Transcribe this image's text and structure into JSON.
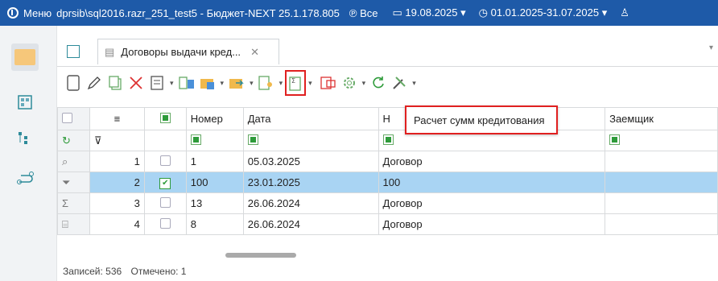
{
  "topbar": {
    "menu": "Меню",
    "title": "dprsib\\sql2016.razr_251_test5 - Бюджет-NEXT 25.1.178.805",
    "filter": "Все",
    "date": "19.08.2025",
    "period": "01.01.2025-31.07.2025"
  },
  "tab": {
    "label": "Договоры выдачи кред..."
  },
  "tooltip": {
    "text": "Расчет сумм кредитования"
  },
  "columns": {
    "number": "Номер",
    "date": "Дата",
    "name": "Н",
    "borrower": "Заемщик"
  },
  "rows": [
    {
      "idx": "1",
      "checked": false,
      "number": "1",
      "date": "05.03.2025",
      "name": "Договор"
    },
    {
      "idx": "2",
      "checked": true,
      "number": "100",
      "date": "23.01.2025",
      "name": "100"
    },
    {
      "idx": "3",
      "checked": false,
      "number": "13",
      "date": "26.06.2024",
      "name": "Договор"
    },
    {
      "idx": "4",
      "checked": false,
      "number": "8",
      "date": "26.06.2024",
      "name": "Договор"
    }
  ],
  "status": {
    "records": "Записей: 536",
    "marked": "Отмечено: 1"
  },
  "colors": {
    "topbar": "#1e5aa8",
    "selected": "#a9d4f3",
    "highlight": "#e02020"
  }
}
